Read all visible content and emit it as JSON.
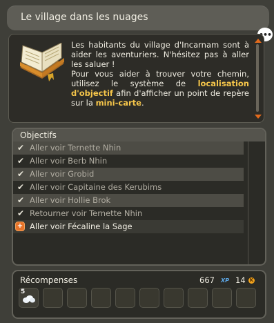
{
  "window": {
    "title": "Le village dans les nuages"
  },
  "chat_icon_text": "•••",
  "dialog": {
    "paragraph1": "Les habitants du village d'Incarnam sont à aider les aventuriers. N'hésitez pas à aller les saluer !",
    "p2_start": "Pour vous aider à trouver votre chemin, utilisez le système de ",
    "p2_highlight1": "localisation d'objectif",
    "p2_middle": " afin d'afficher un point de repère sur la ",
    "p2_highlight2": "mini-carte",
    "p2_end": "."
  },
  "objectives": {
    "header": "Objectifs",
    "items": [
      {
        "label": "Aller voir Ternette Nhin",
        "status": "done"
      },
      {
        "label": "Aller voir Berb Nhin",
        "status": "done"
      },
      {
        "label": "Aller voir Grobid",
        "status": "done"
      },
      {
        "label": "Aller voir Capitaine des Kerubims",
        "status": "done"
      },
      {
        "label": "Aller voir Hollie Brok",
        "status": "done"
      },
      {
        "label": "Retourner voir Ternette Nhin",
        "status": "done"
      },
      {
        "label": "Aller voir Fécaline la Sage",
        "status": "active"
      }
    ],
    "check_glyph": "✔",
    "active_glyph": "+"
  },
  "rewards": {
    "title": "Récompenses",
    "xp": "667",
    "xp_unit": "XP",
    "kamas": "14",
    "kamas_unit": "K",
    "first_slot_quantity": "5",
    "slot_count": 10
  },
  "colors": {
    "highlight": "#f6c64a",
    "accent_orange": "#e8742a",
    "xp_blue": "#5da8e8"
  }
}
